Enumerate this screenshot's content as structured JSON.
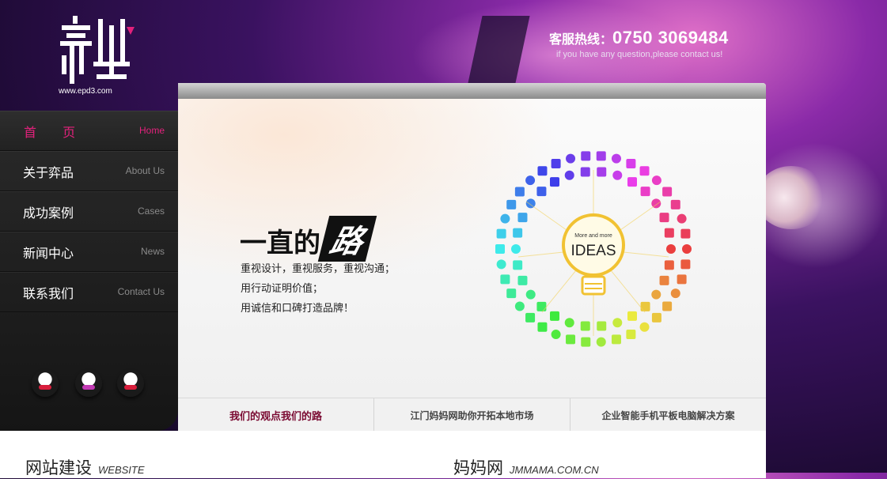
{
  "brand": {
    "logo_char": "弈品",
    "url": "www.epd3.com"
  },
  "hotline": {
    "label": "客服热线：",
    "number": "0750 3069484",
    "sub": "if you have any question,please contact us!"
  },
  "nav": [
    {
      "cn": "首  页",
      "en": "Home",
      "active": true
    },
    {
      "cn": "关于弈品",
      "en": "About Us"
    },
    {
      "cn": "成功案例",
      "en": "Cases"
    },
    {
      "cn": "新闻中心",
      "en": "News"
    },
    {
      "cn": "联系我们",
      "en": "Contact Us"
    }
  ],
  "qq": [
    {
      "icon": "qq-penguin-icon"
    },
    {
      "icon": "qq-penguin-icon"
    },
    {
      "icon": "qq-penguin-icon"
    }
  ],
  "banner": {
    "slogan_part1": "一直的",
    "slogan_part2": "路",
    "lines": [
      "重视设计，重视服务，重视沟通；",
      "用行动证明价值；",
      "用诚信和口碑打造品牌！"
    ],
    "ideas_small": "More and more",
    "ideas_big": "IDEAS"
  },
  "tabs": [
    {
      "label": "我们的观点我们的路",
      "active": true
    },
    {
      "label": "江门妈妈网助你开拓本地市场"
    },
    {
      "label": "企业智能手机平板电脑解决方案"
    }
  ],
  "sections": {
    "left_title": "网站建设",
    "left_sub": "WEBSITE",
    "right_title": "妈妈网",
    "right_sub": "JMMAMA.COM.CN"
  },
  "colors": {
    "accent_pink": "#e3217c",
    "tab_active": "#7a0a32",
    "sidebar_bg": "#1f1f1f"
  }
}
